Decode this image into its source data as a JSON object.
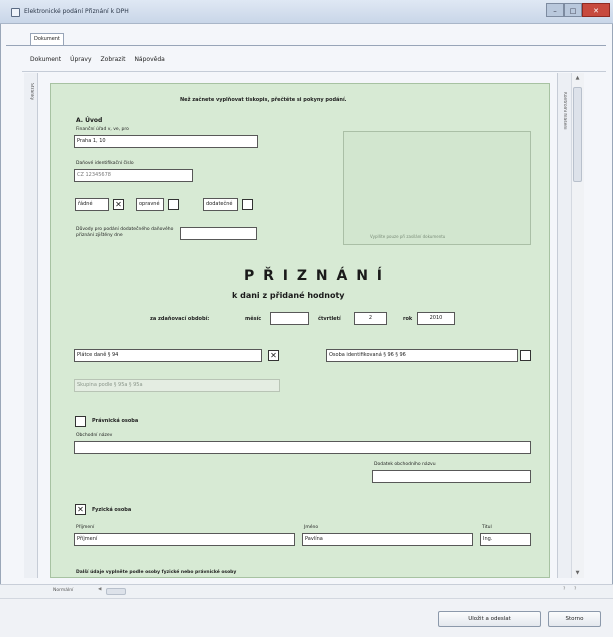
{
  "window": {
    "title": "Elektronické podání Přiznání k DPH",
    "min": "–",
    "max": "□",
    "close": "✕"
  },
  "tab": {
    "label": "Dokument"
  },
  "menu": [
    "Dokument",
    "Úpravy",
    "Zobrazit",
    "Nápověda"
  ],
  "side": {
    "left_label": "Stránky",
    "right_label": "Kontrolní hlášení"
  },
  "banner": "Než začnete vyplňovat tiskopis, přečtěte si pokyny podání.",
  "section_a": {
    "heading": "A. Úvod",
    "office_label": "Finanční úřad v, ve, pro",
    "office_value": "Praha 1, 10",
    "dic_label": "Daňové identifikační číslo",
    "dic_value": "CZ 12345678",
    "opt1": "řádné",
    "opt2": "opravné",
    "opt3": "dodatečné",
    "opt1_mark": "✕",
    "reason_label": "Důvody pro podání dodatečného daňového přiznání zjištěny dne",
    "reason_value": ""
  },
  "photo_label": "Vyplňte pouze při zasílání dokumentu",
  "heading": {
    "title": "P Ř I Z N Á N Í",
    "subtitle": "k dani z přidané hodnoty",
    "period_label": "za zdaňovací období:",
    "month_label": "měsíc",
    "month_value": "",
    "quarter_label": "čtvrtletí",
    "quarter_value": "2",
    "year_label": "rok",
    "year_value": "2010"
  },
  "options": {
    "payer": "Plátce daně § 94",
    "payer_mark": "✕",
    "identified": "Osoba identifikovaná § 96 § 96",
    "group": "Skupina podle § 95a § 95a"
  },
  "legal_person": {
    "label": "Právnická osoba",
    "name_label": "Obchodní název",
    "name_value": "",
    "extra_label": "Dodatek obchodního názvu",
    "extra_value": ""
  },
  "natural_person": {
    "label": "Fyzická osoba",
    "mark": "✕",
    "surname_label": "Příjmení",
    "surname_value": "Příjmení",
    "name_label": "Jméno",
    "name_value": "Pavlína",
    "title_label": "Titul",
    "title_value": "Ing."
  },
  "bottom_note": "Další údaje vyplněte podle osoby fyzické nebo právnické osoby",
  "status": {
    "zoom": "Normální"
  },
  "footer": {
    "btn1": "Uložit a odeslat",
    "btn2": "Storno"
  },
  "colors": {
    "form_bg": "#d7ead4",
    "close_btn": "#c74a3e"
  }
}
